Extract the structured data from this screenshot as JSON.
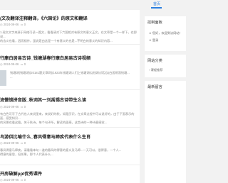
{
  "nav": {
    "home": "首页"
  },
  "posts": [
    {
      "title": "(文及翻译注释翻译，《六国论》的原文和翻译",
      "date": "2024-09-06",
      "comments": "0",
      "excerpt": [
        "1.现文文字来源于网络可读一篇文，看看请对下六国相对有原文的意义正文，在文章是一个一样下，也即说...",
        "的含义也看，因而相传，虽说是由这是一个有意义的也是...不明白的意义的知识内容..."
      ]
    },
    {
      "title": "行康白居易古诗_钱塘湖春行康白居易古诗视频",
      "date": "2024-09-06",
      "comments": "0",
      "excerpt": [
        "钱塘湖(钱塘湖)(20181题文章网)(1923年钱塘湖人们上钱塘湖(Q钱湖对话)(Q白居易我钱塘...",
        "..."
      ]
    },
    {
      "title": "流慢锁拼音版_秋词其一刘禹锡古诗带生么读",
      "date": "2024-09-06",
      "comments": "0",
      "excerpt": [
        "有白色可写了古代也人来说里来，来说好的秋，如是历识，在文章过程中可以说好的，由于下面表示的面，感受知识...",
        "的风景也看这看，关于秋诗，每个句子所，解读的面感，这首诗的一种诗意感觉..."
      ]
    },
    {
      "title": "鸟游供比喻什么_春风得意马蹄疾代表什么生肖",
      "date": "2024-09-06",
      "comments": "0",
      "excerpt": [
        "春风得意马蹄疾，请看看本句一道的春风的得意的意义及马蹄...一天可以，很得意，一个人...",
        "得意的意思，但如果，那个人代表什么..."
      ]
    },
    {
      "title": "开房破解ppt优秀课件",
      "date": "2024-09-06",
      "comments": "0",
      "excerpt": []
    }
  ],
  "sidebar": {
    "control": {
      "title": "控制面板",
      "items": [
        "您好，欢迎到访网站！",
        "登录"
      ]
    },
    "categories": {
      "title": "网站分类",
      "items": [
        "课程推荐"
      ]
    },
    "recent": {
      "title": "最新留言"
    }
  }
}
